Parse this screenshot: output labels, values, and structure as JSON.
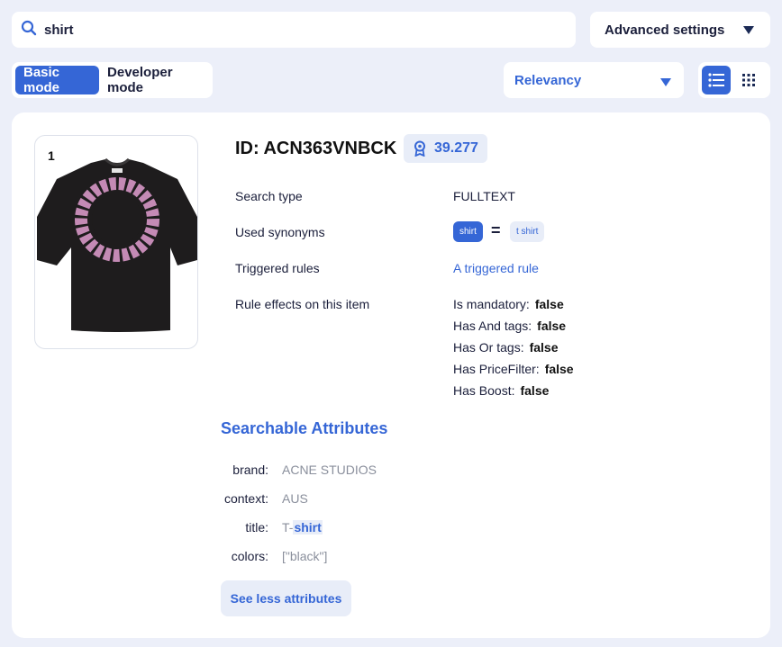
{
  "search": {
    "value": "shirt",
    "icon": "search-icon"
  },
  "advanced_settings": {
    "label": "Advanced settings"
  },
  "modes": {
    "basic": "Basic mode",
    "developer": "Developer mode",
    "active": "basic"
  },
  "sort": {
    "selected": "Relevancy"
  },
  "view": {
    "active": "list",
    "icons": [
      "list-icon",
      "grid-icon"
    ]
  },
  "colors": {
    "accent": "#3566d6",
    "background": "#eceff9",
    "chip_bg": "#e8edf8"
  },
  "product": {
    "rank": "1",
    "id_title": "ID: ACN363VNBCK",
    "score": "39.277",
    "rows": {
      "search_type_label": "Search type",
      "search_type_value": "FULLTEXT",
      "synonyms_label": "Used synonyms",
      "synonym_primary": "shirt",
      "synonym_equals": "=",
      "synonym_secondary": "t shirt",
      "rules_label": "Triggered rules",
      "rules_value": "A triggered rule",
      "effects_label": "Rule effects on this item"
    },
    "effects": [
      {
        "label": "Is mandatory:",
        "value": "false"
      },
      {
        "label": "Has And tags:",
        "value": "false"
      },
      {
        "label": "Has Or tags:",
        "value": "false"
      },
      {
        "label": "Has PriceFilter:",
        "value": "false"
      },
      {
        "label": "Has Boost:",
        "value": "false"
      }
    ],
    "attributes_heading": "Searchable Attributes",
    "attributes": [
      {
        "key": "brand:",
        "value": "ACNE STUDIOS"
      },
      {
        "key": "context:",
        "value": "AUS"
      },
      {
        "key": "title:",
        "value_prefix": "T-",
        "value_highlight": "shirt"
      },
      {
        "key": "colors:",
        "value": "[\"black\"]"
      }
    ],
    "see_less_label": "See less attributes"
  }
}
